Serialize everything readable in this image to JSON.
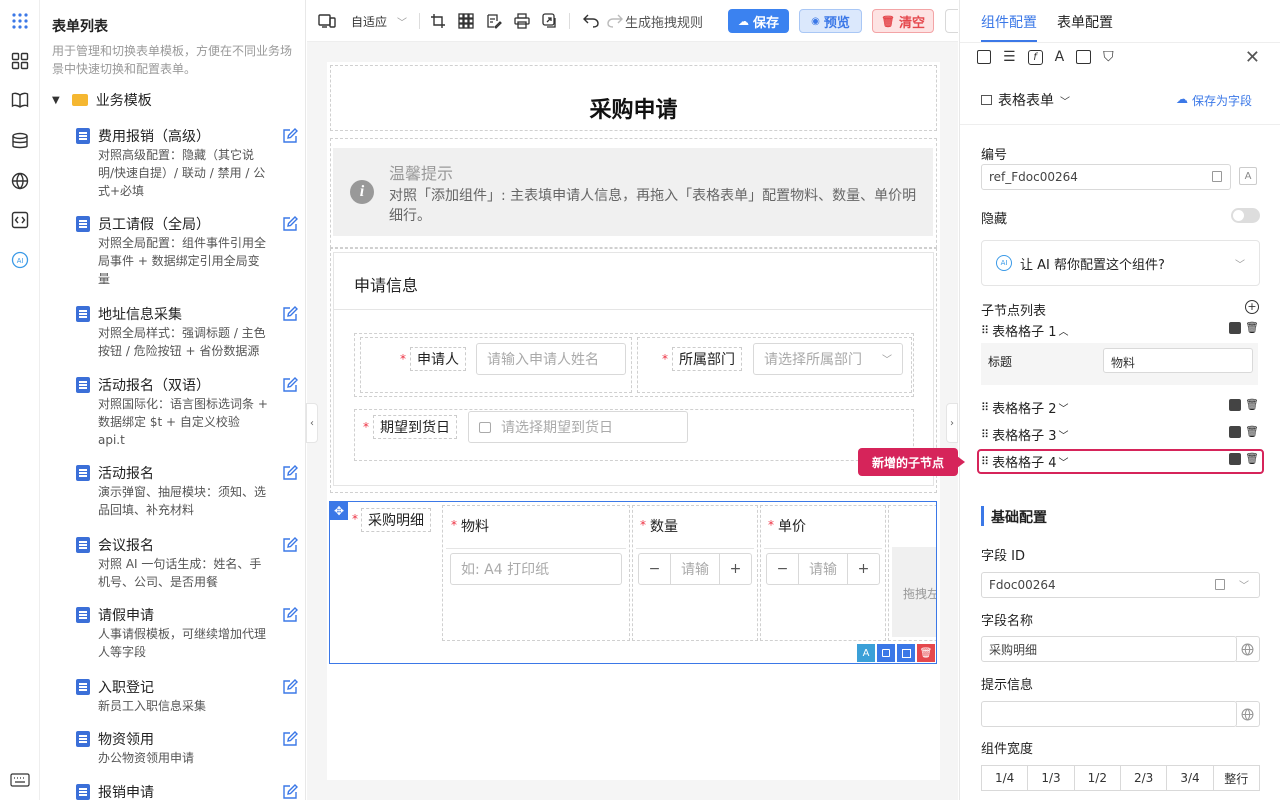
{
  "left_panel": {
    "title": "表单列表",
    "desc": "用于管理和切换表单模板，方便在不同业务场景中快速切换和配置表单。",
    "folder": "业务模板",
    "items": [
      {
        "name": "费用报销（高级）",
        "desc": "对照高级配置：隐藏（其它说明/快速自提）/ 联动 / 禁用 / 公式+必填"
      },
      {
        "name": "员工请假（全局）",
        "desc": "对照全局配置：组件事件引用全局事件 + 数据绑定引用全局变量"
      },
      {
        "name": "地址信息采集",
        "desc": "对照全局样式：强调标题 / 主色按钮 / 危险按钮 + 省份数据源"
      },
      {
        "name": "活动报名（双语）",
        "desc": "对照国际化：语言图标选词条 + 数据绑定 $t + 自定义校验 api.t"
      },
      {
        "name": "活动报名",
        "desc": "演示弹窗、抽屉模块：须知、选品回填、补充材料"
      },
      {
        "name": "会议报名",
        "desc": "对照 AI 一句话生成：姓名、手机号、公司、是否用餐"
      },
      {
        "name": "请假申请",
        "desc": "人事请假模板，可继续增加代理人等字段"
      },
      {
        "name": "入职登记",
        "desc": "新员工入职信息采集"
      },
      {
        "name": "物资领用",
        "desc": "办公物资领用申请"
      },
      {
        "name": "报销申请",
        "desc": ""
      }
    ]
  },
  "toolbar": {
    "adaptive": "自适应",
    "generate_rule": "生成拖拽规则",
    "save": "保存",
    "preview": "预览",
    "clear": "清空"
  },
  "form": {
    "title": "采购申请",
    "hint_title": "温馨提示",
    "hint_text": "对照「添加组件」: 主表填申请人信息，再拖入「表格表单」配置物料、数量、单价明细行。",
    "section_title": "申请信息",
    "applicant_label": "申请人",
    "applicant_placeholder": "请输入申请人姓名",
    "dept_label": "所属部门",
    "dept_placeholder": "请选择所属部门",
    "date_label": "期望到货日",
    "date_placeholder": "请选择期望到货日",
    "detail_label": "采购明细",
    "col_material": "物料",
    "col_qty": "数量",
    "col_price": "单价",
    "material_placeholder": "如: A4 打印纸",
    "qty_placeholder": "请输",
    "price_placeholder": "请输",
    "drag_hint": "拖拽左"
  },
  "right_panel": {
    "tab_component": "组件配置",
    "tab_form": "表单配置",
    "component_type": "表格表单",
    "save_as_field": "保存为字段",
    "id_label": "编号",
    "id_value": "ref_Fdoc00264",
    "hidden_label": "隐藏",
    "ai_prompt": "让 AI 帮你配置这个组件?",
    "children_label": "子节点列表",
    "children": [
      "表格格子 1",
      "表格格子 2",
      "表格格子 3",
      "表格格子 4"
    ],
    "child_title_label": "标题",
    "child_title_value": "物料",
    "new_child_tooltip": "新增的子节点",
    "basic_section": "基础配置",
    "field_id_label": "字段 ID",
    "field_id_value": "Fdoc00264",
    "field_name_label": "字段名称",
    "field_name_value": "采购明细",
    "tip_label": "提示信息",
    "tip_value": "",
    "width_label": "组件宽度",
    "widths": [
      "1/4",
      "1/3",
      "1/2",
      "2/3",
      "3/4",
      "整行"
    ]
  },
  "colors": {
    "primary": "#3b78e7",
    "danger": "#e5484d",
    "highlight": "#d6245a"
  }
}
